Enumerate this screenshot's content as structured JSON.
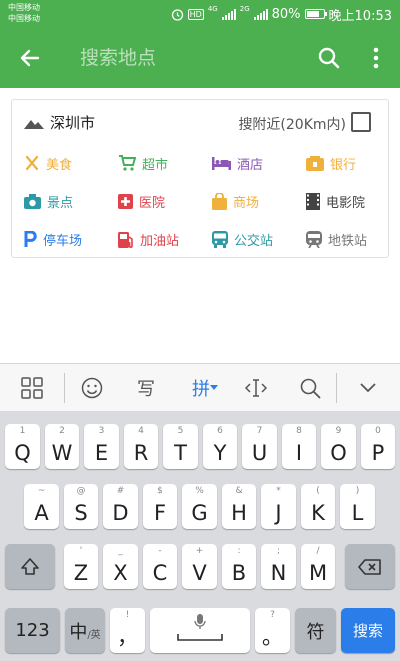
{
  "status_bar": {
    "carrier_1": "中国移动",
    "carrier_2": "中国移动",
    "network_1": "4G",
    "network_2": "2G",
    "hd": "HD",
    "battery": "80%",
    "battery_level": 0.8,
    "time": "晚上10:53"
  },
  "app_bar": {
    "search_placeholder": "搜索地点",
    "back_icon": "arrow-left-icon",
    "search_icon": "search-icon",
    "more_icon": "more-vertical-icon"
  },
  "location": {
    "city": "深圳市",
    "nearby_label": "搜附近(20Km内)",
    "nearby_checked": false
  },
  "categories": [
    {
      "label": "美食",
      "icon": "food-icon",
      "color": "#f0b03c"
    },
    {
      "label": "超市",
      "icon": "cart-icon",
      "color": "#43b15a"
    },
    {
      "label": "酒店",
      "icon": "bed-icon",
      "color": "#8b59b5"
    },
    {
      "label": "银行",
      "icon": "bank-icon",
      "color": "#f0b03c"
    },
    {
      "label": "景点",
      "icon": "camera-icon",
      "color": "#2c9aa6"
    },
    {
      "label": "医院",
      "icon": "hospital-icon",
      "color": "#e0424b"
    },
    {
      "label": "商场",
      "icon": "shopping-bag-icon",
      "color": "#f0b03c"
    },
    {
      "label": "电影院",
      "icon": "film-icon",
      "color": "#444444"
    },
    {
      "label": "停车场",
      "icon": "parking-icon",
      "color": "#2b7de9"
    },
    {
      "label": "加油站",
      "icon": "gas-station-icon",
      "color": "#e0424b"
    },
    {
      "label": "公交站",
      "icon": "bus-icon",
      "color": "#2c9aa6"
    },
    {
      "label": "地铁站",
      "icon": "subway-icon",
      "color": "#777777"
    }
  ],
  "keyboard": {
    "toolbar": {
      "menu_icon": "grid-icon",
      "emoji_icon": "smiley-icon",
      "handwrite": "写",
      "pinyin": "拼",
      "cursor_icon": "cursor-icon",
      "search_icon": "search-icon",
      "collapse_icon": "chevron-down-icon"
    },
    "row1": [
      {
        "key": "Q",
        "sub": "1"
      },
      {
        "key": "W",
        "sub": "2"
      },
      {
        "key": "E",
        "sub": "3"
      },
      {
        "key": "R",
        "sub": "4"
      },
      {
        "key": "T",
        "sub": "5"
      },
      {
        "key": "Y",
        "sub": "6"
      },
      {
        "key": "U",
        "sub": "7"
      },
      {
        "key": "I",
        "sub": "8"
      },
      {
        "key": "O",
        "sub": "9"
      },
      {
        "key": "P",
        "sub": "0"
      }
    ],
    "row2": [
      {
        "key": "A",
        "sub": "~"
      },
      {
        "key": "S",
        "sub": "@"
      },
      {
        "key": "D",
        "sub": "#"
      },
      {
        "key": "F",
        "sub": "$"
      },
      {
        "key": "G",
        "sub": "%"
      },
      {
        "key": "H",
        "sub": "&"
      },
      {
        "key": "J",
        "sub": "*"
      },
      {
        "key": "K",
        "sub": "("
      },
      {
        "key": "L",
        "sub": ")"
      }
    ],
    "row3": [
      {
        "key": "Z",
        "sub": "'"
      },
      {
        "key": "X",
        "sub": "_"
      },
      {
        "key": "C",
        "sub": "-"
      },
      {
        "key": "V",
        "sub": "+"
      },
      {
        "key": "B",
        "sub": ":"
      },
      {
        "key": "N",
        "sub": ";"
      },
      {
        "key": "M",
        "sub": "/"
      }
    ],
    "shift_icon": "shift-icon",
    "backspace_icon": "backspace-icon",
    "num_key": "123",
    "lang_key_main": "中",
    "lang_key_sub": "/英",
    "comma_key": "，",
    "comma_sub": "!",
    "space_icon": "microphone-icon",
    "period_key": "。",
    "period_sub": "?",
    "symbol_key": "符",
    "search_key": "搜索"
  }
}
